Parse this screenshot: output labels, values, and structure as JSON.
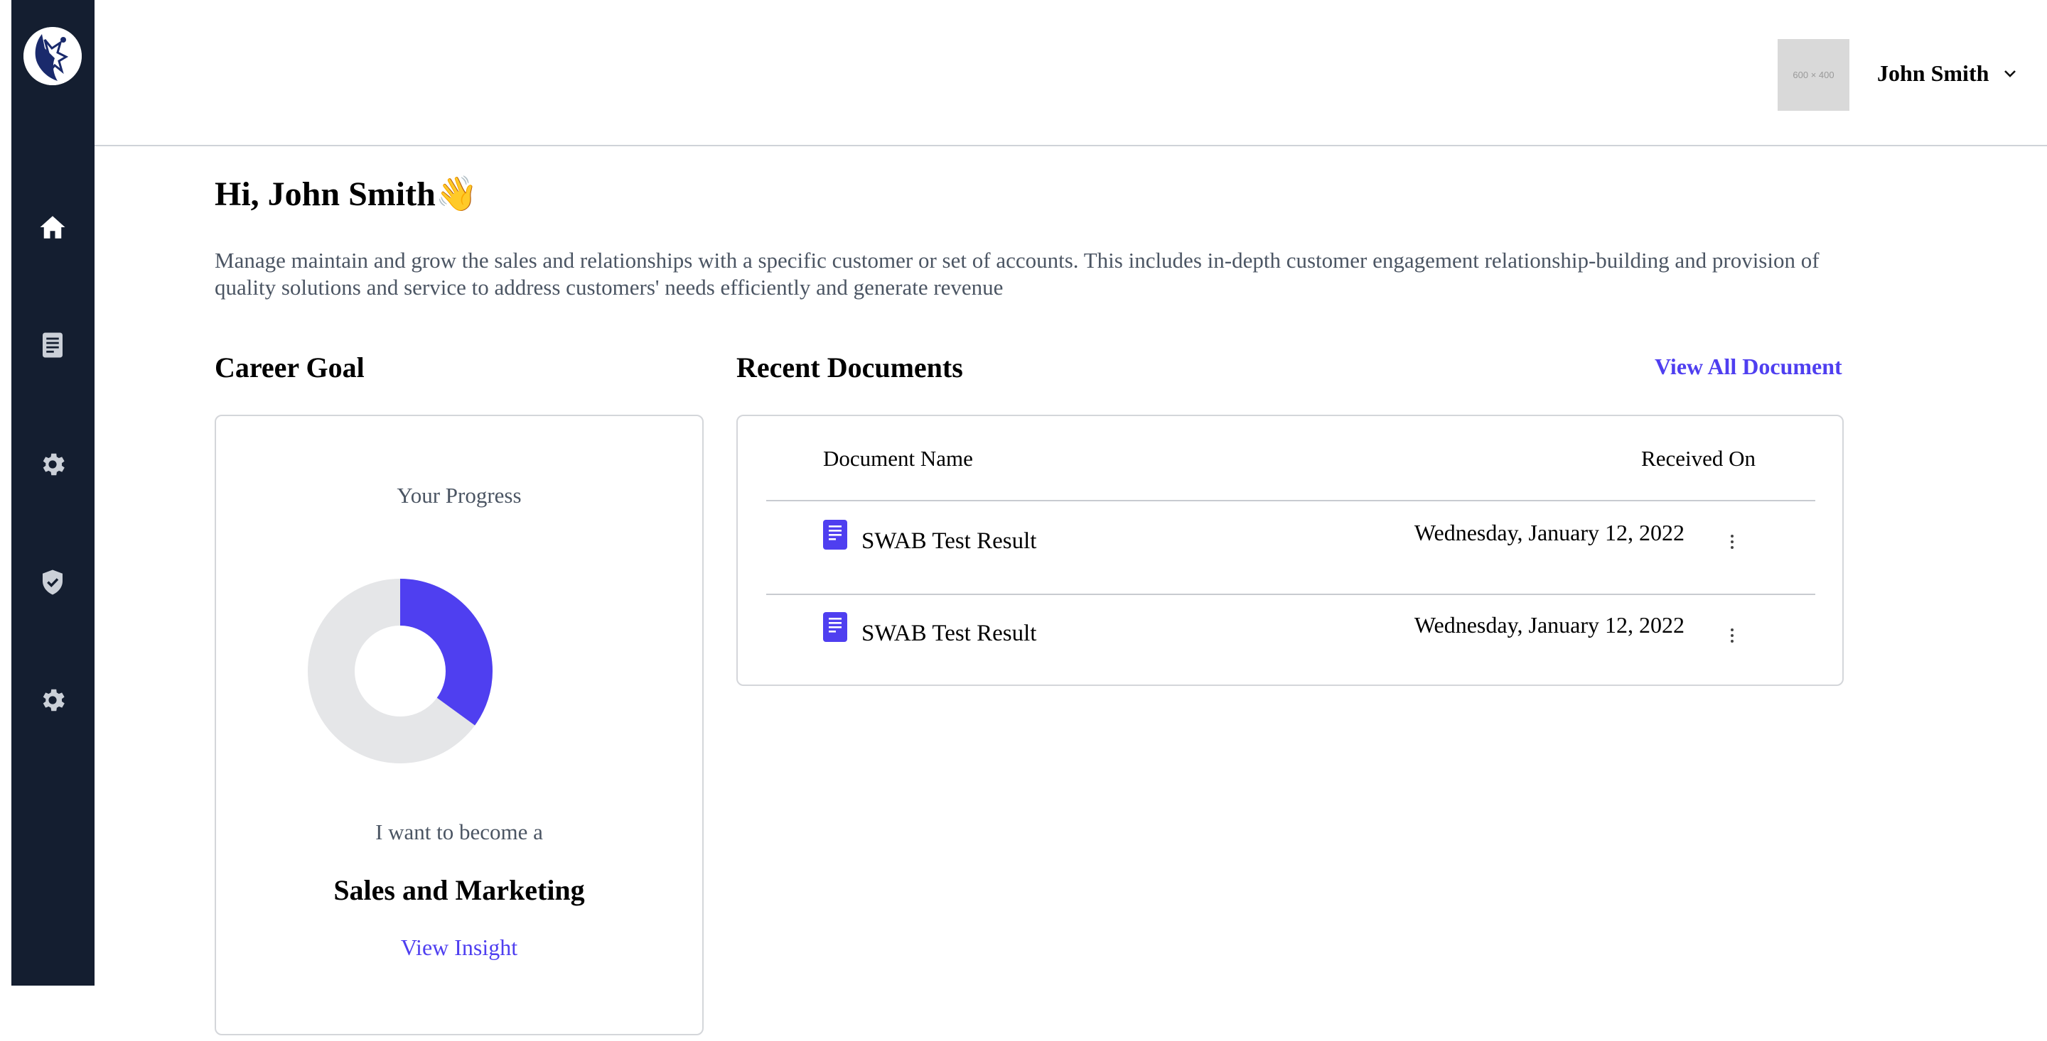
{
  "header": {
    "avatar_placeholder": "600 × 400",
    "user_name": "John Smith"
  },
  "sidebar": {
    "items": [
      {
        "name": "home",
        "icon": "home-icon"
      },
      {
        "name": "documents",
        "icon": "document-icon"
      },
      {
        "name": "settings",
        "icon": "gear-icon"
      },
      {
        "name": "security",
        "icon": "shield-check-icon"
      },
      {
        "name": "settings-2",
        "icon": "gear-icon"
      }
    ]
  },
  "main": {
    "greeting": "Hi, John Smith👋",
    "intro": "Manage maintain and grow the sales and relationships with a specific customer or set of accounts. This includes in-depth customer engagement relationship-building and provision of quality solutions and service to address customers' needs efficiently and generate revenue"
  },
  "career_goal": {
    "title": "Career Goal",
    "progress_label": "Your Progress",
    "progress_fraction": 0.35,
    "become_label": "I want to become a",
    "goal": "Sales and Marketing",
    "view_insight": "View Insight"
  },
  "recent_documents": {
    "title": "Recent Documents",
    "view_all": "View All Document",
    "columns": {
      "name": "Document Name",
      "date": "Received On"
    },
    "rows": [
      {
        "name": "SWAB Test Result",
        "date": "Wednesday, January 12, 2022"
      },
      {
        "name": "SWAB Test Result",
        "date": "Wednesday, January 12, 2022"
      }
    ]
  },
  "colors": {
    "sidebar_bg": "#141e30",
    "accent": "#4f3ff0",
    "donut_track": "#e5e6e8"
  }
}
